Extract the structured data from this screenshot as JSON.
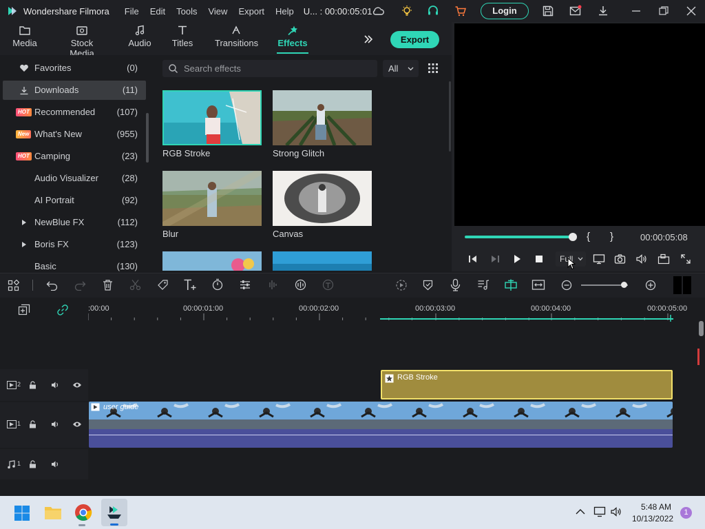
{
  "titlebar": {
    "app_title": "Wondershare Filmora",
    "menus": [
      "File",
      "Edit",
      "Tools",
      "View",
      "Export",
      "Help"
    ],
    "project": "U... : 00:00:05:01",
    "login_label": "Login"
  },
  "tabs": [
    {
      "label": "Media",
      "icon": "folder-icon"
    },
    {
      "label": "Stock Media",
      "icon": "stock-media-icon"
    },
    {
      "label": "Audio",
      "icon": "music-note-icon"
    },
    {
      "label": "Titles",
      "icon": "text-t-icon"
    },
    {
      "label": "Transitions",
      "icon": "transitions-icon"
    },
    {
      "label": "Effects",
      "icon": "effects-star-icon",
      "active": true
    }
  ],
  "export_label": "Export",
  "sidebar": {
    "items": [
      {
        "label": "Favorites",
        "count": "(0)",
        "icon": "heart-icon"
      },
      {
        "label": "Downloads",
        "count": "(11)",
        "icon": "download-icon",
        "active": true
      },
      {
        "label": "Recommended",
        "count": "(107)",
        "badge": "HOT"
      },
      {
        "label": "What's New",
        "count": "(955)",
        "badge": "New"
      },
      {
        "label": "Camping",
        "count": "(23)",
        "badge": "HOT"
      },
      {
        "label": "Audio Visualizer",
        "count": "(28)"
      },
      {
        "label": "AI Portrait",
        "count": "(92)"
      },
      {
        "label": "NewBlue FX",
        "count": "(112)",
        "expand": true
      },
      {
        "label": "Boris FX",
        "count": "(123)",
        "expand": true
      },
      {
        "label": "Basic",
        "count": "(130)"
      }
    ]
  },
  "search": {
    "placeholder": "Search effects",
    "filter": "All"
  },
  "effects": [
    {
      "label": "RGB Stroke",
      "selected": true
    },
    {
      "label": "Strong Glitch"
    },
    {
      "label": "Blur"
    },
    {
      "label": "Canvas"
    }
  ],
  "preview": {
    "in_mark": "{",
    "out_mark": "}",
    "timecode": "00:00:05:08",
    "progress": 1.0,
    "quality": "Full"
  },
  "timeline": {
    "ruler_labels": [
      ":00:00",
      "00:00:01:00",
      "00:00:02:00",
      "00:00:03:00",
      "00:00:04:00",
      "00:00:05:00"
    ],
    "effect_clip": "RGB Stroke",
    "video_clip": "user guide",
    "tracks": [
      {
        "label": "2",
        "type": "video"
      },
      {
        "label": "1",
        "type": "video"
      },
      {
        "label": "1",
        "type": "audio"
      }
    ],
    "zoom_level": 0.8
  },
  "taskbar": {
    "time": "5:48 AM",
    "date": "10/13/2022",
    "notification_count": "1"
  },
  "colors": {
    "accent": "#2fd6b6",
    "effect_clip": "#a08c3e",
    "video_clip": "#4a4f9a",
    "panel": "#1b1c1f"
  }
}
